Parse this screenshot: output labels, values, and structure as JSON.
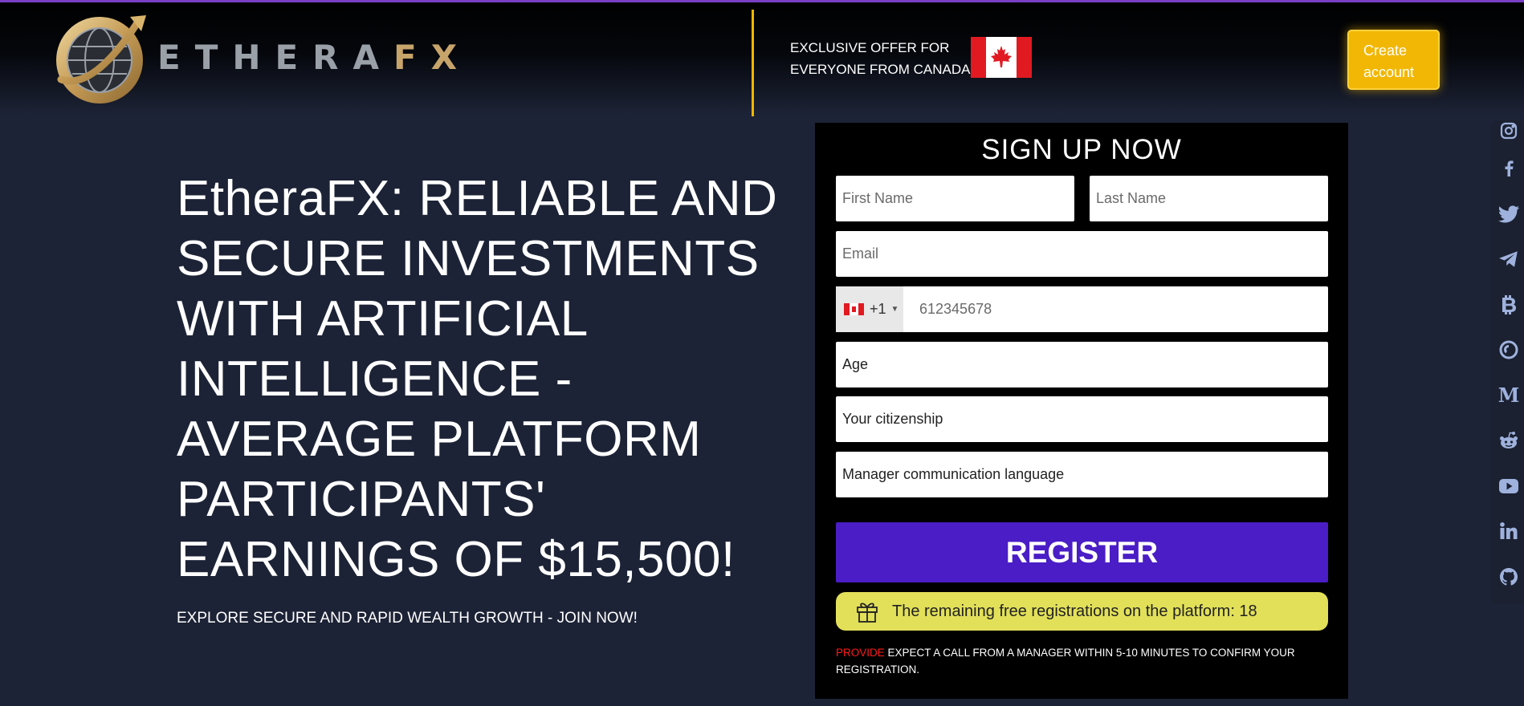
{
  "brand": {
    "logo_text_main": "ETHERA",
    "logo_text_accent": "FX",
    "accent_color": "#f2b705"
  },
  "header": {
    "offer_text": "EXCLUSIVE OFFER FOR EVERYONE FROM CANADA",
    "flag_icon": "canada-flag-icon",
    "create_account_label": "Create account"
  },
  "hero": {
    "title": "EtheraFX: RELIABLE AND SECURE INVESTMENTS WITH ARTIFICIAL INTELLIGENCE - AVERAGE PLATFORM PARTICIPANTS' EARNINGS OF $15,500!",
    "subtitle": "EXPLORE SECURE AND RAPID WEALTH GROWTH - JOIN NOW!"
  },
  "form": {
    "title": "SIGN UP NOW",
    "first_name_placeholder": "First Name",
    "last_name_placeholder": "Last Name",
    "email_placeholder": "Email",
    "phone_code": "+1",
    "phone_placeholder": "612345678",
    "age_placeholder": "Age",
    "citizenship_placeholder": "Your citizenship",
    "language_placeholder": "Manager communication language",
    "register_label": "REGISTER",
    "register_color": "#4a1dc6",
    "remaining_text": "The remaining free registrations on the platform: 18",
    "notice_highlight": "PROVIDE",
    "notice_text": " EXPECT A CALL FROM A MANAGER WITHIN 5-10 MINUTES TO CONFIRM YOUR REGISTRATION."
  },
  "social": [
    "instagram-icon",
    "facebook-icon",
    "twitter-icon",
    "telegram-icon",
    "bitcoin-icon",
    "coin-icon",
    "medium-icon",
    "reddit-icon",
    "youtube-icon",
    "linkedin-icon",
    "github-icon"
  ]
}
